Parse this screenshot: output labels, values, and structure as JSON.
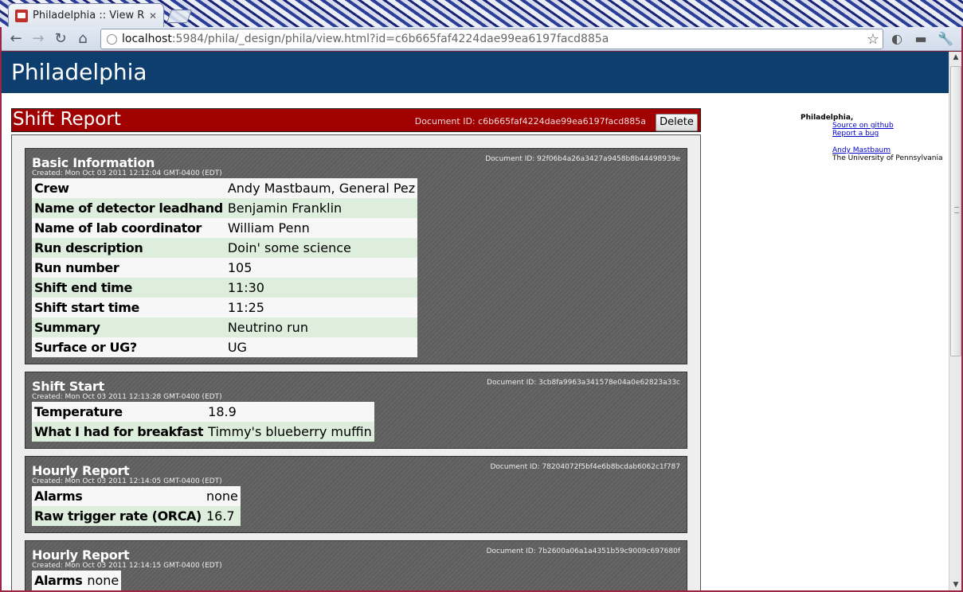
{
  "browser": {
    "tab_title": "Philadelphia :: View R...",
    "tab_close": "✕",
    "url_host": "localhost",
    "url_rest": ":5984/phila/_design/phila/view.html?id=c6b665faf4224dae99ea6197facd885a",
    "nav": {
      "back": "←",
      "forward": "→",
      "reload": "↻",
      "home": "⌂"
    },
    "star": "☆",
    "ext1": "◐",
    "ext2": "▬",
    "wrench": "🔧"
  },
  "site": {
    "title": "Philadelphia"
  },
  "report": {
    "title": "Shift Report",
    "doc_id": "Document ID: c6b665faf4224dae99ea6197facd885a",
    "delete_label": "Delete"
  },
  "entries": [
    {
      "title": "Basic Information",
      "created": "Created: Mon Oct 03 2011 12:12:04 GMT-0400 (EDT)",
      "doc_id": "Document ID: 92f06b4a26a3427a9458b8b44498939e",
      "rows": [
        {
          "k": "Crew",
          "v": "Andy Mastbaum, General Pez"
        },
        {
          "k": "Name of detector leadhand",
          "v": "Benjamin Franklin"
        },
        {
          "k": "Name of lab coordinator",
          "v": "William Penn"
        },
        {
          "k": "Run description",
          "v": "Doin' some science"
        },
        {
          "k": "Run number",
          "v": "105"
        },
        {
          "k": "Shift end time",
          "v": "11:30"
        },
        {
          "k": "Shift start time",
          "v": "11:25"
        },
        {
          "k": "Summary",
          "v": "Neutrino run"
        },
        {
          "k": "Surface or UG?",
          "v": "UG"
        }
      ]
    },
    {
      "title": "Shift Start",
      "created": "Created: Mon Oct 03 2011 12:13:28 GMT-0400 (EDT)",
      "doc_id": "Document ID: 3cb8fa9963a341578e04a0e62823a33c",
      "rows": [
        {
          "k": "Temperature",
          "v": "18.9"
        },
        {
          "k": "What I had for breakfast",
          "v": "Timmy's blueberry muffin"
        }
      ]
    },
    {
      "title": "Hourly Report",
      "created": "Created: Mon Oct 03 2011 12:14:05 GMT-0400 (EDT)",
      "doc_id": "Document ID: 78204072f5bf4e6b8bcdab6062c1f787",
      "rows": [
        {
          "k": "Alarms",
          "v": "none"
        },
        {
          "k": "Raw trigger rate (ORCA)",
          "v": "16.7"
        }
      ]
    },
    {
      "title": "Hourly Report",
      "created": "Created: Mon Oct 03 2011 12:14:15 GMT-0400 (EDT)",
      "doc_id": "Document ID: 7b2600a06a1a4351b59c9009c697680f",
      "rows": [
        {
          "k": "Alarms",
          "v": "none"
        }
      ]
    }
  ],
  "sidebar": {
    "title": "Philadelphia,",
    "source_link": "Source on github",
    "bug_link": "Report a bug",
    "author_link": "Andy Mastbaum",
    "affiliation": "The University of Pennsylvania"
  }
}
